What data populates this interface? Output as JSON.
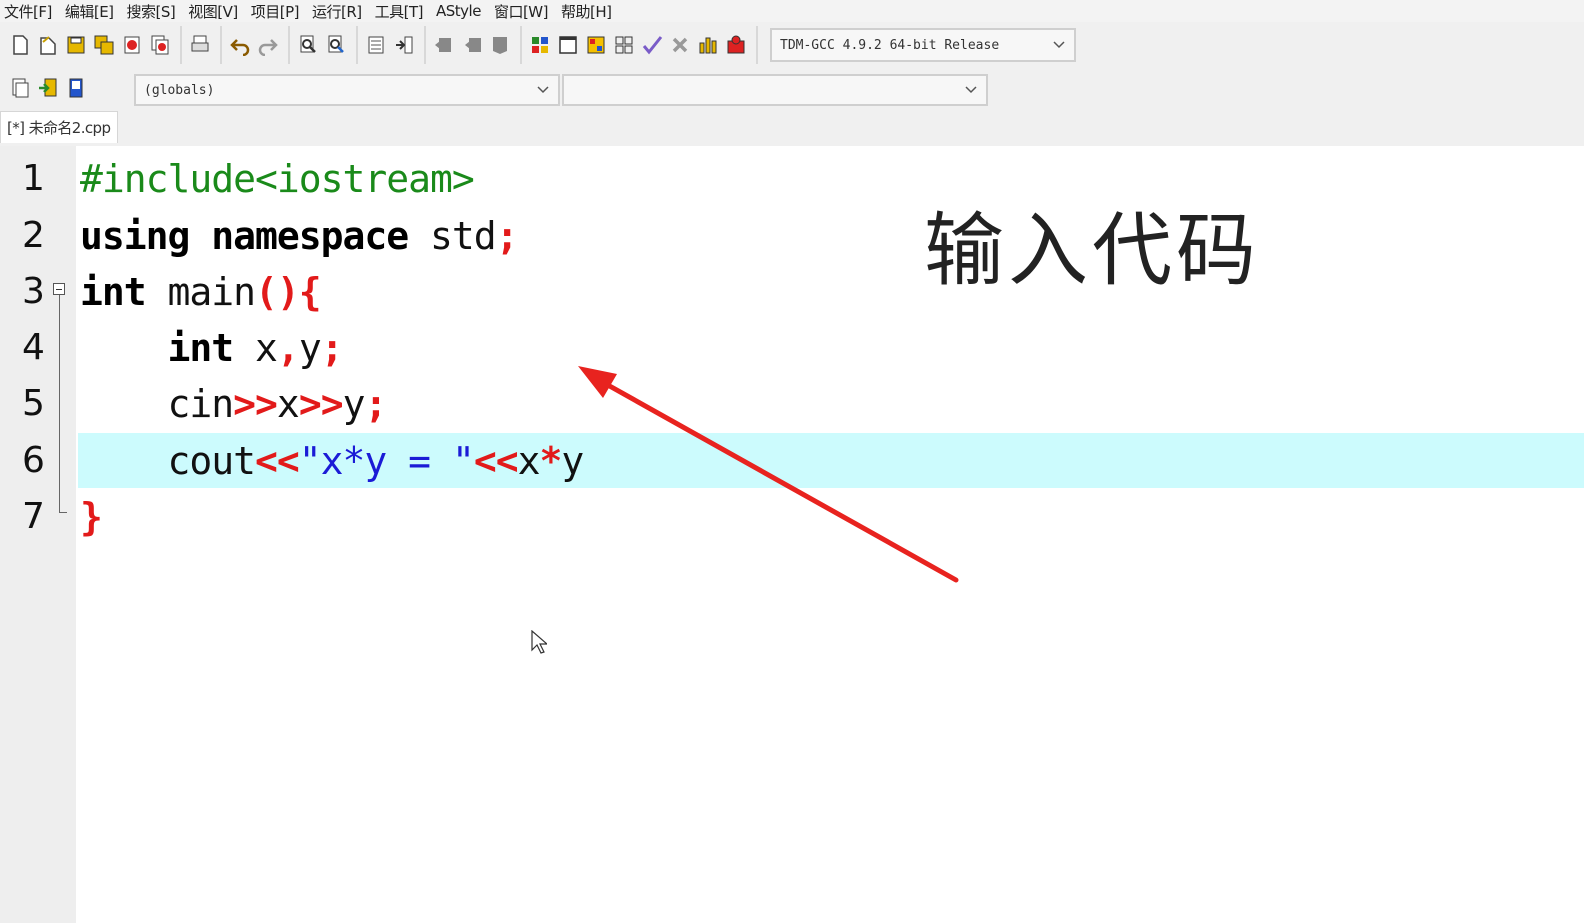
{
  "menu": [
    "文件[F]",
    "编辑[E]",
    "搜索[S]",
    "视图[V]",
    "项目[P]",
    "运行[R]",
    "工具[T]",
    "AStyle",
    "窗口[W]",
    "帮助[H]"
  ],
  "toolbar": {
    "compiler": "TDM-GCC 4.9.2 64-bit Release",
    "scope": "(globals)",
    "member": ""
  },
  "tab": {
    "label": "[*] 未命名2.cpp"
  },
  "editor": {
    "line_numbers": [
      "1",
      "2",
      "3",
      "4",
      "5",
      "6",
      "7"
    ],
    "highlighted_line": 6
  },
  "annotation": {
    "text": "输入代码",
    "arrow_color": "#e8231f"
  },
  "colors": {
    "highlight": "#ccfbfd",
    "keyword": "#000000",
    "preprocessor": "#1a8a1a",
    "symbol": "#e21a1a",
    "string": "#1b1bd6"
  }
}
